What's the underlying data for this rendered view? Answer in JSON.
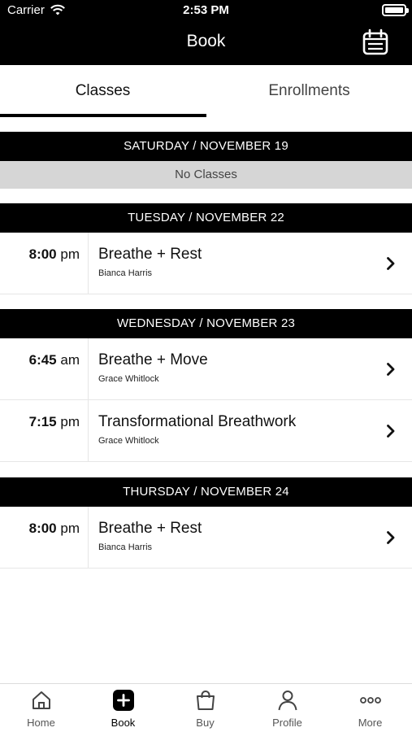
{
  "status_bar": {
    "carrier": "Carrier",
    "time": "2:53 PM"
  },
  "nav": {
    "title": "Book",
    "calendar_icon": "calendar-icon"
  },
  "tabs": [
    {
      "label": "Classes",
      "active": true
    },
    {
      "label": "Enrollments",
      "active": false
    }
  ],
  "days": [
    {
      "header": "SATURDAY / NOVEMBER 19",
      "empty_text": "No Classes",
      "classes": []
    },
    {
      "header": "TUESDAY / NOVEMBER 22",
      "classes": [
        {
          "time_num": "8:00",
          "time_suffix": "pm",
          "title": "Breathe + Rest",
          "teacher": "Bianca Harris"
        }
      ]
    },
    {
      "header": "WEDNESDAY / NOVEMBER 23",
      "classes": [
        {
          "time_num": "6:45",
          "time_suffix": "am",
          "title": "Breathe + Move",
          "teacher": "Grace Whitlock"
        },
        {
          "time_num": "7:15",
          "time_suffix": "pm",
          "title": "Transformational Breathwork",
          "teacher": "Grace Whitlock"
        }
      ]
    },
    {
      "header": "THURSDAY / NOVEMBER 24",
      "classes": [
        {
          "time_num": "8:00",
          "time_suffix": "pm",
          "title": "Breathe + Rest",
          "teacher": "Bianca Harris"
        }
      ]
    }
  ],
  "tab_bar": [
    {
      "label": "Home",
      "icon": "home-icon",
      "active": false
    },
    {
      "label": "Book",
      "icon": "plus-square-icon",
      "active": true
    },
    {
      "label": "Buy",
      "icon": "shopping-bag-icon",
      "active": false
    },
    {
      "label": "Profile",
      "icon": "person-icon",
      "active": false
    },
    {
      "label": "More",
      "icon": "more-dots-icon",
      "active": false
    }
  ]
}
